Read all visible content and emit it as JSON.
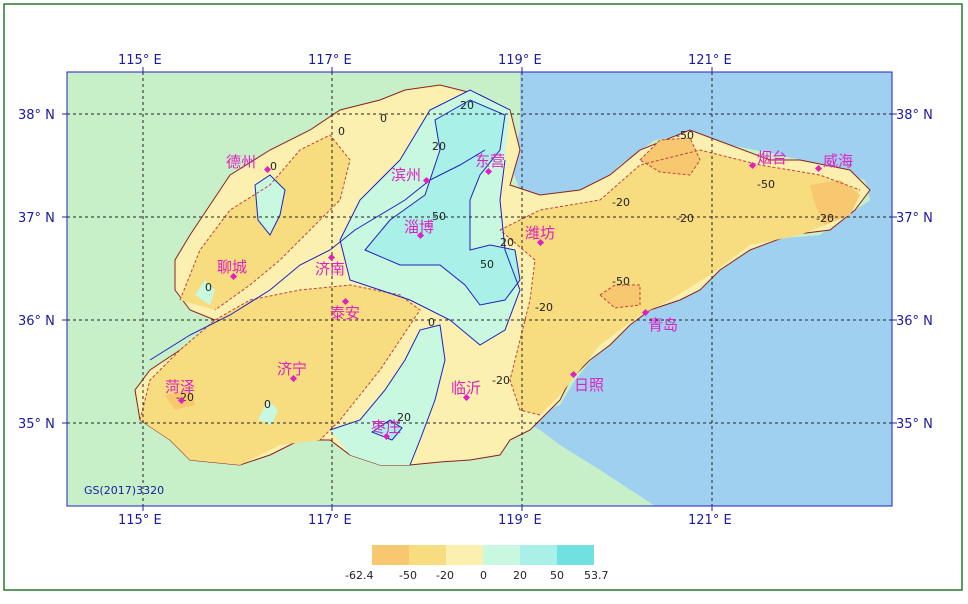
{
  "map": {
    "lon_labels": [
      "115° E",
      "117° E",
      "119° E",
      "121° E"
    ],
    "lat_labels": [
      "38° N",
      "37° N",
      "36° N",
      "35° N"
    ],
    "cities": [
      {
        "name": "德州"
      },
      {
        "name": "滨州"
      },
      {
        "name": "东营"
      },
      {
        "name": "烟台"
      },
      {
        "name": "威海"
      },
      {
        "name": "淄博"
      },
      {
        "name": "潍坊"
      },
      {
        "name": "聊城"
      },
      {
        "name": "济南"
      },
      {
        "name": "泰安"
      },
      {
        "name": "青岛"
      },
      {
        "name": "济宁"
      },
      {
        "name": "菏泽"
      },
      {
        "name": "临沂"
      },
      {
        "name": "日照"
      },
      {
        "name": "枣庄"
      }
    ],
    "contour_labels": [
      "20",
      "20",
      "50",
      "20",
      "50",
      "0",
      "0",
      "0",
      "0",
      "0",
      "0",
      "-50",
      "-50",
      "-50",
      "-20",
      "-20",
      "-20",
      "-20",
      "-20",
      "-20",
      "20"
    ],
    "credit": "GS(2017)3320",
    "colors": {
      "land_outside": "#c8f0c8",
      "sea": "#a0d0f0",
      "frame_border": "#2a7a2a",
      "axis_border": "#2020c0",
      "city_marker": "#e020c0",
      "contour_positive": "#2020c0",
      "contour_negative": "#c04040"
    }
  },
  "legend": {
    "labels": [
      "-62.4",
      "-50",
      "-20",
      "0",
      "20",
      "50",
      "53.7"
    ],
    "colors": [
      "#f8c870",
      "#f8dc80",
      "#fcf0b0",
      "#c8f8e0",
      "#a8f0e8",
      "#70e0e0"
    ]
  }
}
